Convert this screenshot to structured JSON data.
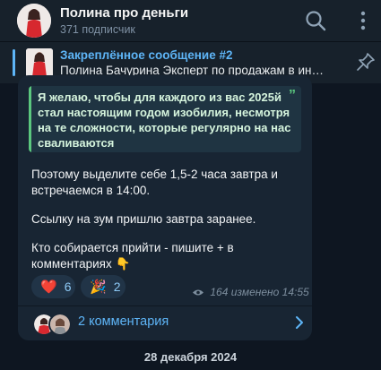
{
  "channel": {
    "title": "Полина про деньги",
    "subtitle": "371 подписчик"
  },
  "header_icons": [
    "search-icon",
    "more-vertical-icon"
  ],
  "pinned": {
    "title": "Закреплённое сообщение #2",
    "text": "Полина Бачурина Эксперт по продажам в инфобизнесе",
    "icon": "pin-list-icon"
  },
  "message": {
    "quote": "Я желаю, чтобы для каждого из вас 2025й стал настоящим годом изобилия, несмотря на те сложности, которые регулярно на нас сваливаются",
    "quote_mark": "”",
    "paragraph1": "Поэтому выделите себе 1,5-2 часа завтра и встречаемся в 14:00.",
    "paragraph2": "Ссылку на зум пришлю завтра заранее.",
    "paragraph3": "Кто собирается прийти - пишите + в комментариях 👇",
    "reactions": [
      {
        "emoji": "❤️",
        "count": "6"
      },
      {
        "emoji": "🎉",
        "count": "2"
      }
    ],
    "views": "164",
    "edited_label": "изменено",
    "time": "14:55",
    "comments_label": "2 комментария"
  },
  "date_separator": "28 декабря 2024",
  "colors": {
    "background": "#0e1621",
    "header": "#17212b",
    "bubble": "#182533",
    "accent": "#5eb5f7",
    "quote_accent": "#5bc77e"
  }
}
